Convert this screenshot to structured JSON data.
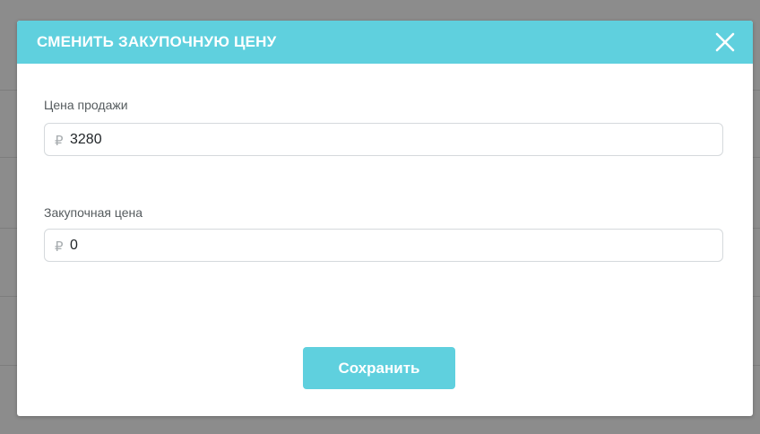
{
  "colors": {
    "accent": "#5fd0de",
    "overlay": "#8c8c8c",
    "text": "#222629",
    "label": "#555b5e",
    "currency": "#a8adb0"
  },
  "modal": {
    "title": "СМЕНИТЬ ЗАКУПОЧНУЮ ЦЕНУ",
    "close_icon": "close-icon",
    "fields": [
      {
        "label": "Цена продажи",
        "currency": "₽",
        "value": "3280"
      },
      {
        "label": "Закупочная цена",
        "currency": "₽",
        "value": "0"
      }
    ],
    "save_label": "Сохранить"
  }
}
